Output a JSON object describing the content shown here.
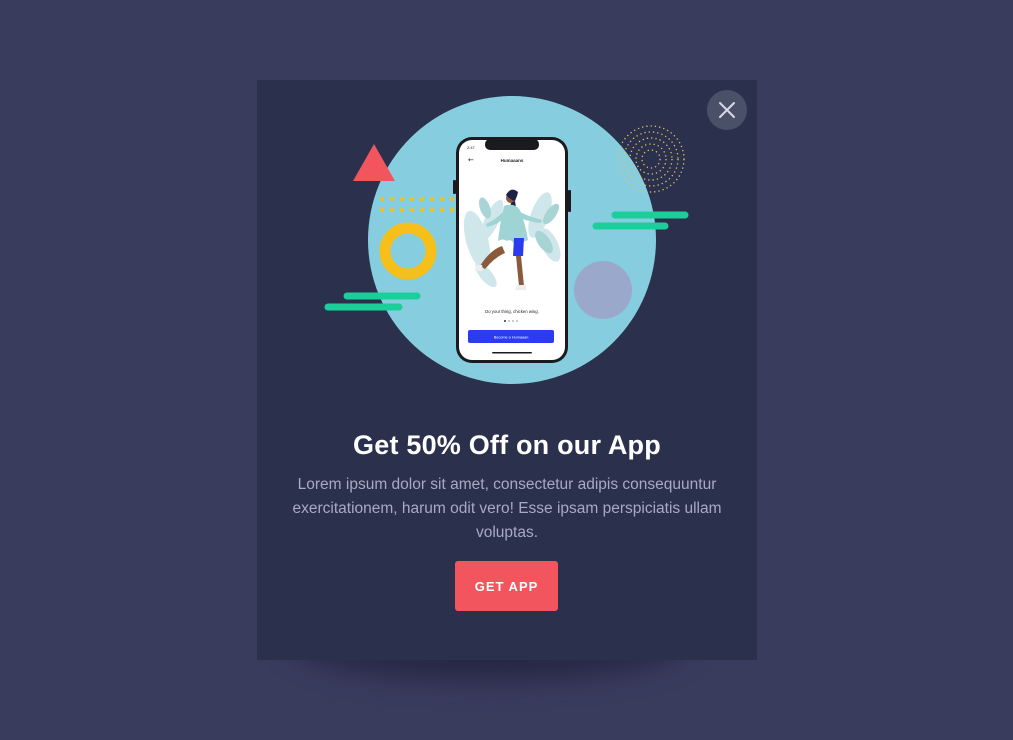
{
  "modal": {
    "title": "Get 50% Off on our App",
    "description": "Lorem ipsum dolor sit amet, consectetur adipis consequuntur exercitationem, harum odit vero! Esse ipsam perspiciatis ullam voluptas.",
    "cta_label": "GET APP",
    "close_icon": "close-icon"
  },
  "phone_screen": {
    "status_time": "2:47",
    "header": "Humaaans",
    "caption": "Do your thing, chicken wing.",
    "button_label": "Become a Humaaan"
  },
  "colors": {
    "page_background": "#3a3c5e",
    "modal_background": "#2b304c",
    "cta": "#f2555e",
    "circle": "#86cedf",
    "accent_green": "#1ccf9a",
    "accent_yellow": "#f7bf1a",
    "accent_red": "#f2555e",
    "accent_lavender": "#9aa8cc",
    "phone_button": "#2b3cf0"
  }
}
